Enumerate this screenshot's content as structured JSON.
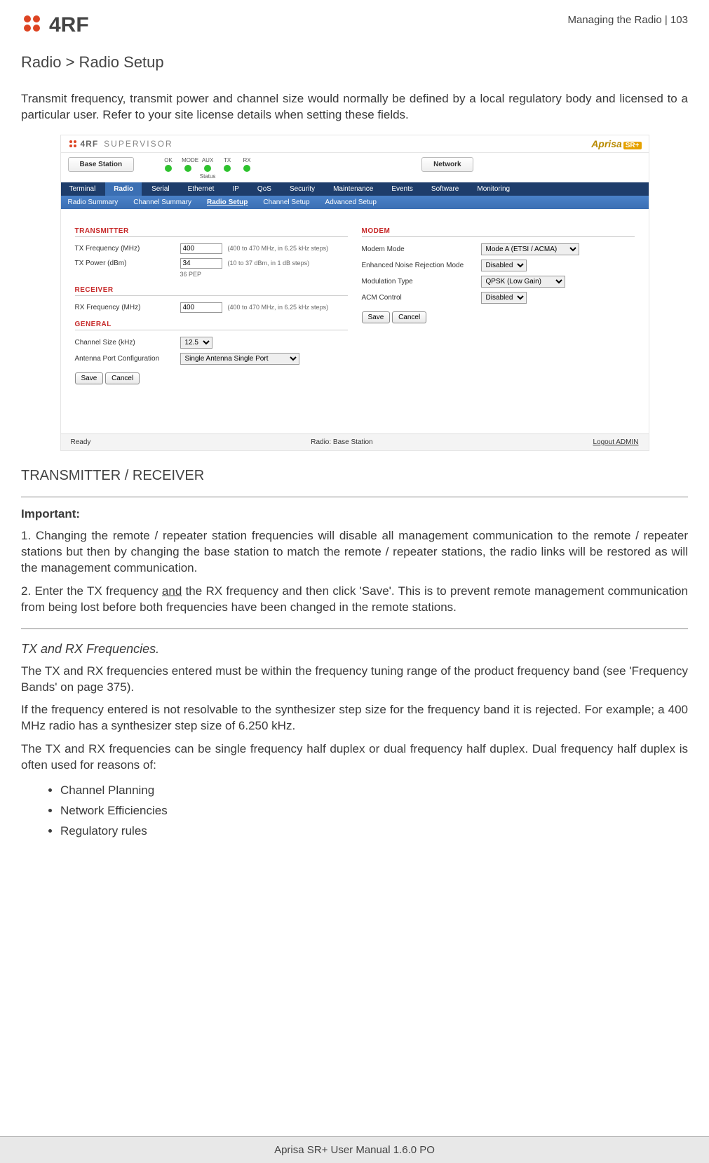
{
  "header": {
    "logo_text": "4RF",
    "section": "Managing the Radio",
    "sep": "  |  ",
    "page_num": "103"
  },
  "title": "Radio > Radio Setup",
  "intro": "Transmit frequency, transmit power and channel size would normally be defined by a local regulatory body and licensed to a particular user. Refer to your site license details when setting these fields.",
  "ss": {
    "brand": "4RF",
    "brand_sub": "SUPERVISOR",
    "aprisa": "Aprisa",
    "aprisa_sr": "SR+",
    "station_tab": "Base Station",
    "network_tab": "Network",
    "led_headers": [
      "OK",
      "MODE",
      "AUX",
      "TX",
      "RX"
    ],
    "status_label": "Status",
    "nav": [
      "Terminal",
      "Radio",
      "Serial",
      "Ethernet",
      "IP",
      "QoS",
      "Security",
      "Maintenance",
      "Events",
      "Software",
      "Monitoring"
    ],
    "nav_active": "Radio",
    "subnav": [
      "Radio Summary",
      "Channel Summary",
      "Radio Setup",
      "Channel Setup",
      "Advanced Setup"
    ],
    "subnav_active": "Radio Setup",
    "left": {
      "transmitter": "TRANSMITTER",
      "tx_freq_lbl": "TX Frequency (MHz)",
      "tx_freq_val": "400",
      "tx_freq_hint": "(400 to 470 MHz, in 6.25 kHz steps)",
      "tx_pwr_lbl": "TX Power (dBm)",
      "tx_pwr_val": "34",
      "tx_pwr_hint": "(10 to 37 dBm, in 1 dB steps)",
      "tx_pwr_note": "36 PEP",
      "receiver": "RECEIVER",
      "rx_freq_lbl": "RX Frequency (MHz)",
      "rx_freq_val": "400",
      "rx_freq_hint": "(400 to 470 MHz, in 6.25 kHz steps)",
      "general": "GENERAL",
      "ch_size_lbl": "Channel Size (kHz)",
      "ch_size_val": "12.5",
      "ant_lbl": "Antenna Port Configuration",
      "ant_val": "Single Antenna Single Port",
      "save": "Save",
      "cancel": "Cancel"
    },
    "right": {
      "modem": "MODEM",
      "modem_mode_lbl": "Modem Mode",
      "modem_mode_val": "Mode A (ETSI / ACMA)",
      "enr_lbl": "Enhanced Noise Rejection Mode",
      "enr_val": "Disabled",
      "mod_type_lbl": "Modulation Type",
      "mod_type_val": "QPSK (Low Gain)",
      "acm_lbl": "ACM Control",
      "acm_val": "Disabled",
      "save": "Save",
      "cancel": "Cancel"
    },
    "footer": {
      "ready": "Ready",
      "station": "Radio: Base Station",
      "logout": "Logout ADMIN"
    }
  },
  "sec2_title": "TRANSMITTER / RECEIVER",
  "important_title": "Important:",
  "important_1": "1. Changing the remote / repeater station frequencies will disable all management communication to the remote / repeater stations but then by changing the base station to match the remote / repeater stations, the radio links will be restored as will the management communication.",
  "imp2_a": "2. Enter the TX frequency ",
  "imp2_u": "and",
  "imp2_b": " the RX frequency and then click 'Save'. This is to prevent remote management communication from being lost before both frequencies have been changed in the remote stations.",
  "sub_title": "TX and RX Frequencies.",
  "p1": "The TX and RX frequencies entered must be within the frequency tuning range of the product frequency band (see 'Frequency Bands' on page 375).",
  "p2": "If the frequency entered is not resolvable to the synthesizer step size for the frequency band it is rejected. For example; a 400 MHz radio has a synthesizer step size of 6.250 kHz.",
  "p3": "The TX and RX frequencies can be single frequency half duplex or dual frequency half duplex. Dual frequency half duplex is often used for reasons of:",
  "bullets": [
    "Channel Planning",
    "Network Efficiencies",
    "Regulatory rules"
  ],
  "footer_text": "Aprisa SR+ User Manual 1.6.0 PO"
}
